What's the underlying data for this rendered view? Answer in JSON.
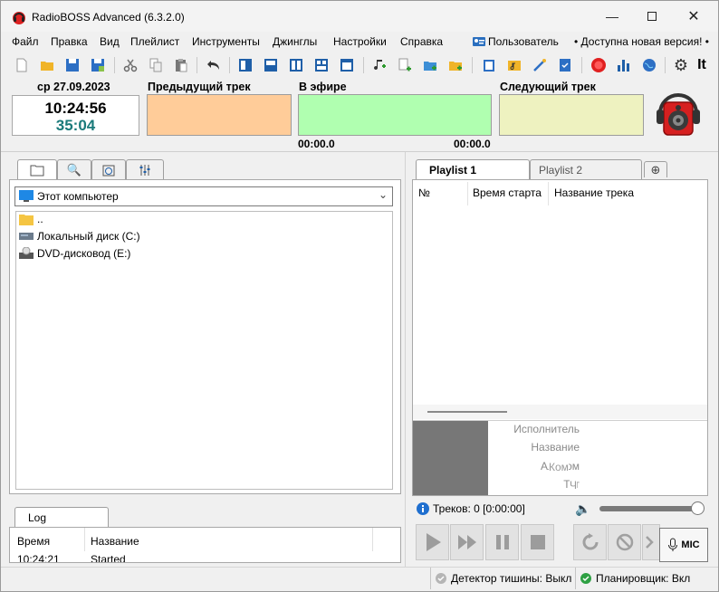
{
  "window": {
    "title": "RadioBOSS Advanced (6.3.2.0)"
  },
  "menu": {
    "items": [
      "Файл",
      "Правка",
      "Вид",
      "Плейлист",
      "Инструменты",
      "Джинглы",
      "Настройки",
      "Справка"
    ],
    "user": "Пользователь",
    "update": "• Доступна новая версия! •",
    "it": "It"
  },
  "clock": {
    "date": "ср 27.09.2023",
    "time": "10:24:56",
    "elapsed": "35:04"
  },
  "tracks": {
    "prev_label": "Предыдущий трек",
    "onair_label": "В эфире",
    "next_label": "Следующий трек",
    "elapsed": "00:00.0",
    "remaining": "00:00.0",
    "colors": {
      "prev": "#ffcc99",
      "onair": "#b0ffb0",
      "next": "#eef2c0"
    }
  },
  "browser": {
    "location": "Этот компьютер",
    "items": [
      "..",
      "Локальный диск (C:)",
      "DVD-дисковод (E:)"
    ]
  },
  "playlist": {
    "tabs": [
      "Playlist 1",
      "Playlist 2"
    ],
    "columns": [
      "№",
      "Время старта",
      "Название трека"
    ],
    "meta_labels": [
      "Исполнитель",
      "Название",
      "Альбом",
      "Тег"
    ],
    "meta_overlaps": [
      "Ком",
      "Ч"
    ],
    "tracks_info": "Треков: 0 [0:00:00]",
    "mic_label": "MIC"
  },
  "log": {
    "tab": "Log",
    "columns": [
      "Время",
      "Название"
    ],
    "rows": [
      {
        "time": "10:24:21",
        "name": "Started"
      }
    ]
  },
  "status": {
    "silence": "Детектор тишины: Выкл",
    "scheduler": "Планировщик: Вкл"
  }
}
